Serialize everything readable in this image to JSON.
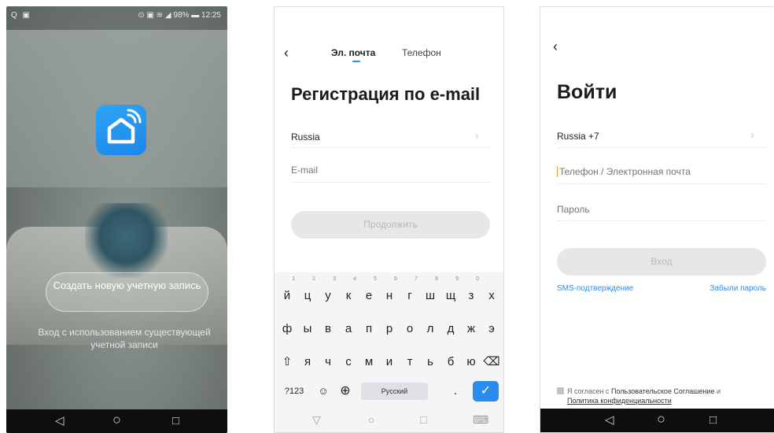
{
  "screen1": {
    "status_left": "Q ▣",
    "status_right": "⊙ ▣ ≋ ◢ 98% ▬ 12:25",
    "create_account": "Создать новую учетную запись",
    "login_existing": "Вход с использованием существующей учетной записи",
    "brand_color": "#1c86ea"
  },
  "screen2": {
    "back": "‹",
    "tab_email": "Эл. почта",
    "tab_phone": "Телефон",
    "title": "Регистрация по e-mail",
    "country": "Russia",
    "country_chevron": "›",
    "email_placeholder": "E-mail",
    "continue_button": "Продолжить",
    "keyboard": {
      "row1": [
        {
          "k": "й",
          "n": "1"
        },
        {
          "k": "ц",
          "n": "2"
        },
        {
          "k": "у",
          "n": "3"
        },
        {
          "k": "к",
          "n": "4"
        },
        {
          "k": "е",
          "n": "5"
        },
        {
          "k": "н",
          "n": "6"
        },
        {
          "k": "г",
          "n": "7"
        },
        {
          "k": "ш",
          "n": "8"
        },
        {
          "k": "щ",
          "n": "9"
        },
        {
          "k": "з",
          "n": "0"
        },
        {
          "k": "х",
          "n": ""
        }
      ],
      "row2": [
        "ф",
        "ы",
        "в",
        "а",
        "п",
        "р",
        "о",
        "л",
        "д",
        "ж",
        "э"
      ],
      "row3": [
        "⇧",
        "я",
        "ч",
        "с",
        "м",
        "и",
        "т",
        "ь",
        "б",
        "ю",
        "⌫"
      ],
      "row4_left": "?123",
      "row4_emoji": "☺",
      "row4_globe": "⊕",
      "space_label": "Русский",
      "period": ".",
      "enter": "✓",
      "accent": "#2b8cf0"
    },
    "nav": [
      "▽",
      "○",
      "□",
      "⌨"
    ]
  },
  "screen3": {
    "back": "‹",
    "title": "Войти",
    "country": "Russia +7",
    "country_chevron": "›",
    "phone_placeholder": "Телефон / Электронная почта",
    "password_placeholder": "Пароль",
    "login_button": "Вход",
    "sms_link": "SMS-подтверждение",
    "forgot_link": "Забыли пароль",
    "agree_prefix": "Я согласен с ",
    "agree_terms": "Пользовательское Соглашение",
    "agree_and": " и ",
    "agree_privacy": "Политика конфиденциальности",
    "link_color": "#2b8cf0"
  },
  "navbar": {
    "back": "◁",
    "home": "○",
    "recent": "□"
  }
}
